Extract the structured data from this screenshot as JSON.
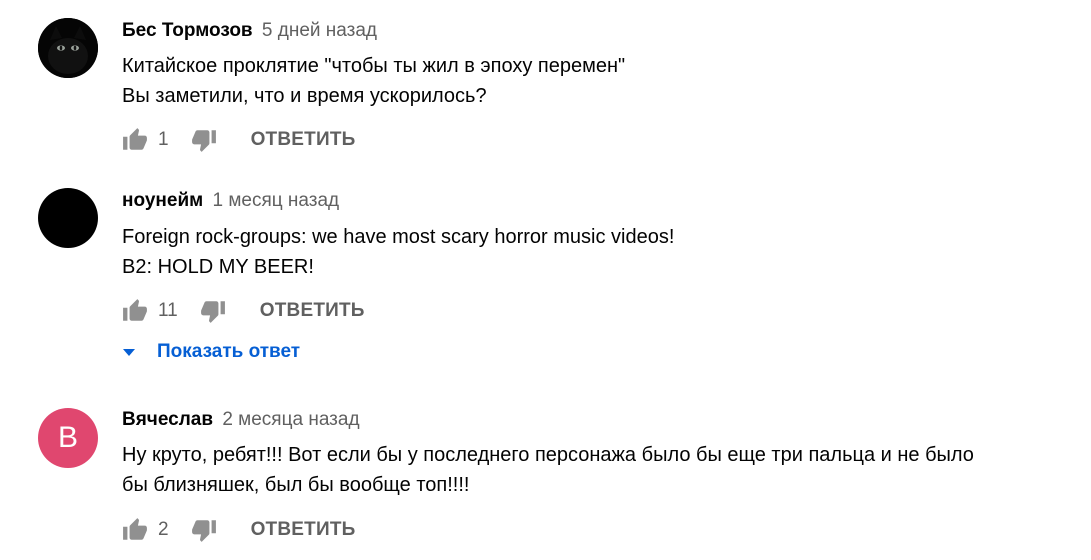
{
  "comments": [
    {
      "author": "Бес Тормозов",
      "time": "5 дней назад",
      "lines": [
        "Китайское проклятие \"чтобы ты жил в эпоху перемен\"",
        "Вы заметили, что и время ускорилось?"
      ],
      "likes": "1",
      "reply_label": "ОТВЕТИТЬ",
      "avatar": "cat-photo"
    },
    {
      "author": "ноунейм",
      "time": "1 месяц назад",
      "lines": [
        "Foreign rock-groups: we have most scary horror music videos!",
        "B2: HOLD MY BEER!"
      ],
      "likes": "11",
      "reply_label": "ОТВЕТИТЬ",
      "avatar": "black-circle",
      "show_replies_label": "Показать ответ"
    },
    {
      "author": "Вячеслав",
      "time": "2 месяца назад",
      "lines": [
        "Ну круто, ребят!!! Вот если бы у последнего персонажа было бы еще три пальца и не было",
        "бы близняшек, был бы вообще топ!!!!"
      ],
      "likes": "2",
      "reply_label": "ОТВЕТИТЬ",
      "avatar_letter": "В",
      "avatar_color": "#e0476f"
    }
  ],
  "icons": {
    "like": "thumbs-up-icon",
    "dislike": "thumbs-down-icon",
    "expand": "caret-down-icon"
  },
  "colors": {
    "link": "#065fd4",
    "secondary_text": "#606060",
    "icon": "#909090"
  }
}
